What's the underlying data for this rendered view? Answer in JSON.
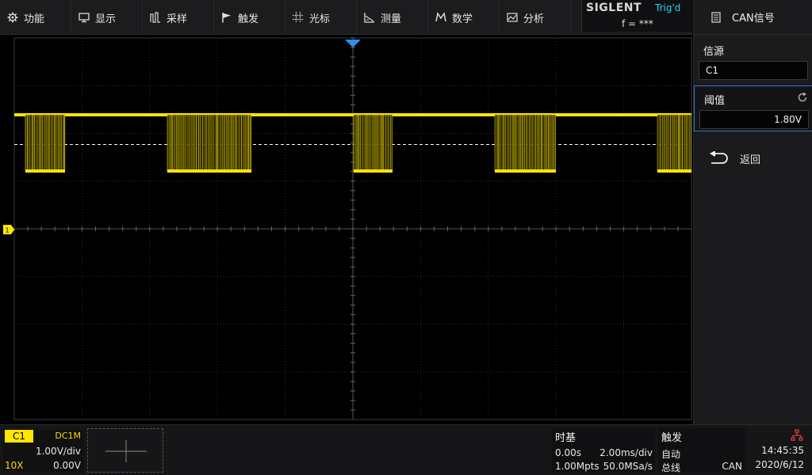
{
  "menu": [
    {
      "label": "功能",
      "icon": "gear-icon"
    },
    {
      "label": "显示",
      "icon": "display-icon"
    },
    {
      "label": "采样",
      "icon": "acquire-icon"
    },
    {
      "label": "触发",
      "icon": "flag-icon"
    },
    {
      "label": "光标",
      "icon": "cursor-icon"
    },
    {
      "label": "测量",
      "icon": "measure-icon"
    },
    {
      "label": "数学",
      "icon": "math-icon"
    },
    {
      "label": "分析",
      "icon": "analysis-icon"
    }
  ],
  "brand": "SIGLENT",
  "trigger_state": "Trig'd",
  "frequency": "f = ***",
  "panel": {
    "title": "CAN信号",
    "source_label": "信源",
    "source_value": "C1",
    "threshold_label": "阈值",
    "threshold_value": "1.80V",
    "back_label": "返回"
  },
  "channel1": {
    "name": "C1",
    "coupling": "DC1M",
    "scale": "1.00V/div",
    "probe": "10X",
    "offset": "0.00V",
    "color": "#ffe600"
  },
  "timebase": {
    "title": "时基",
    "delay": "0.00s",
    "scale": "2.00ms/div",
    "memory": "1.00Mpts",
    "sample_rate": "50.0MSa/s"
  },
  "trigger": {
    "title": "触发",
    "mode": "自动",
    "type": "总线",
    "source": "CAN"
  },
  "clock": {
    "time": "14:45:35",
    "date": "2020/6/12"
  }
}
